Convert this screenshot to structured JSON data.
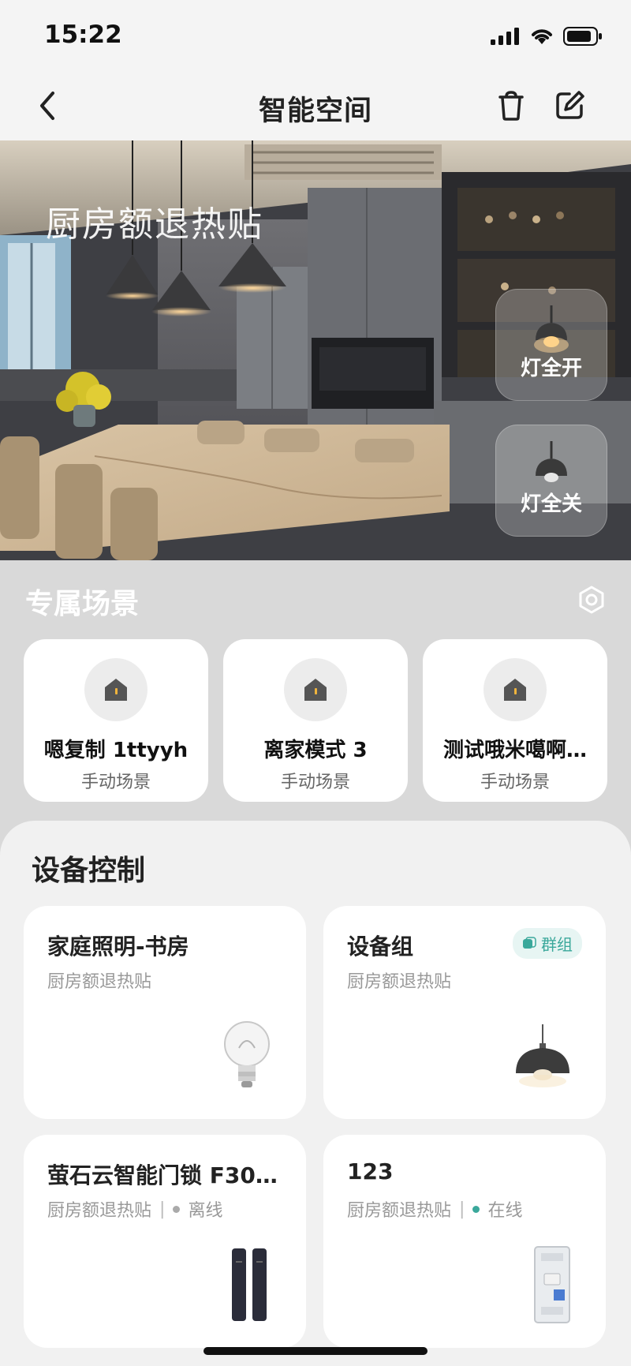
{
  "status_bar": {
    "time": "15:22"
  },
  "nav": {
    "title": "智能空间"
  },
  "hero": {
    "room_name": "厨房额退热贴",
    "all_on_label": "灯全开",
    "all_off_label": "灯全关"
  },
  "scenes": {
    "title": "专属场景",
    "items": [
      {
        "name": "嗯复制 1ttyyh",
        "type": "手动场景"
      },
      {
        "name": "离家模式 3",
        "type": "手动场景"
      },
      {
        "name": "测试哦米噶啊…",
        "type": "手动场景"
      }
    ]
  },
  "devices": {
    "title": "设备控制",
    "items": [
      {
        "name": "家庭照明-书房",
        "room": "厨房额退热贴",
        "status": ""
      },
      {
        "name": "设备组",
        "room": "厨房额退热贴",
        "status": "",
        "badge": "群组"
      },
      {
        "name": "萤石云智能门锁 F30…",
        "room": "厨房额退热贴",
        "status": "离线"
      },
      {
        "name": "123",
        "room": "厨房额退热贴",
        "status": "在线"
      }
    ]
  },
  "colors": {
    "online": "#3aa89b",
    "offline": "#aaaaaa",
    "badge_bg": "#e7f5f3"
  }
}
